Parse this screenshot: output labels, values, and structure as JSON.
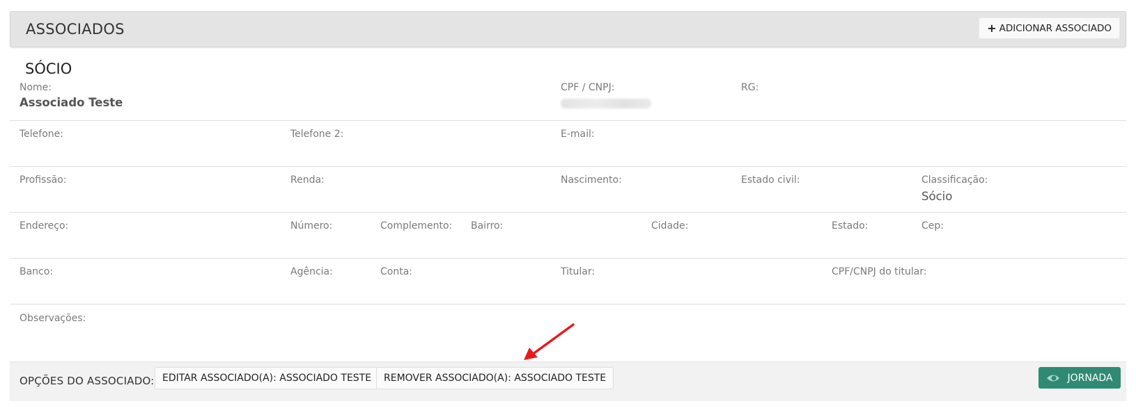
{
  "header": {
    "title": "ASSOCIADOS",
    "add_button_label": "ADICIONAR ASSOCIADO",
    "add_button_icon": "plus-icon"
  },
  "section": {
    "title": "SÓCIO"
  },
  "fields": {
    "nome": {
      "label": "Nome:",
      "value": "Associado Teste"
    },
    "cpf": {
      "label": "CPF / CNPJ:",
      "value": ""
    },
    "rg": {
      "label": "RG:",
      "value": ""
    },
    "telefone": {
      "label": "Telefone:",
      "value": ""
    },
    "telefone2": {
      "label": "Telefone 2:",
      "value": ""
    },
    "email": {
      "label": "E-mail:",
      "value": ""
    },
    "profissao": {
      "label": "Profissão:",
      "value": ""
    },
    "renda": {
      "label": "Renda:",
      "value": ""
    },
    "nascimento": {
      "label": "Nascimento:",
      "value": ""
    },
    "estado_civil": {
      "label": "Estado civil:",
      "value": ""
    },
    "classificacao": {
      "label": "Classificação:",
      "value": "Sócio"
    },
    "endereco": {
      "label": "Endereço:",
      "value": ""
    },
    "numero": {
      "label": "Número:",
      "value": ""
    },
    "complemento": {
      "label": "Complemento:",
      "value": ""
    },
    "bairro": {
      "label": "Bairro:",
      "value": ""
    },
    "cidade": {
      "label": "Cidade:",
      "value": ""
    },
    "estado": {
      "label": "Estado:",
      "value": ""
    },
    "cep": {
      "label": "Cep:",
      "value": ""
    },
    "banco": {
      "label": "Banco:",
      "value": ""
    },
    "agencia": {
      "label": "Agência:",
      "value": ""
    },
    "conta": {
      "label": "Conta:",
      "value": ""
    },
    "titular": {
      "label": "Titular:",
      "value": ""
    },
    "cpf_titular": {
      "label": "CPF/CNPJ do titular:",
      "value": ""
    },
    "observacoes": {
      "label": "Observações:",
      "value": ""
    }
  },
  "footer": {
    "label": "OPÇÕES DO ASSOCIADO:",
    "edit_button": "EDITAR ASSOCIADO(A): ASSOCIADO TESTE",
    "remove_button": "REMOVER ASSOCIADO(A): ASSOCIADO TESTE",
    "jornada_button": "JORNADA",
    "jornada_icon": "eye-icon",
    "jornada_color": "#2f8a73"
  },
  "annotation": {
    "arrow_color": "#e8191d",
    "arrow_icon": "red-arrow-annotation"
  }
}
